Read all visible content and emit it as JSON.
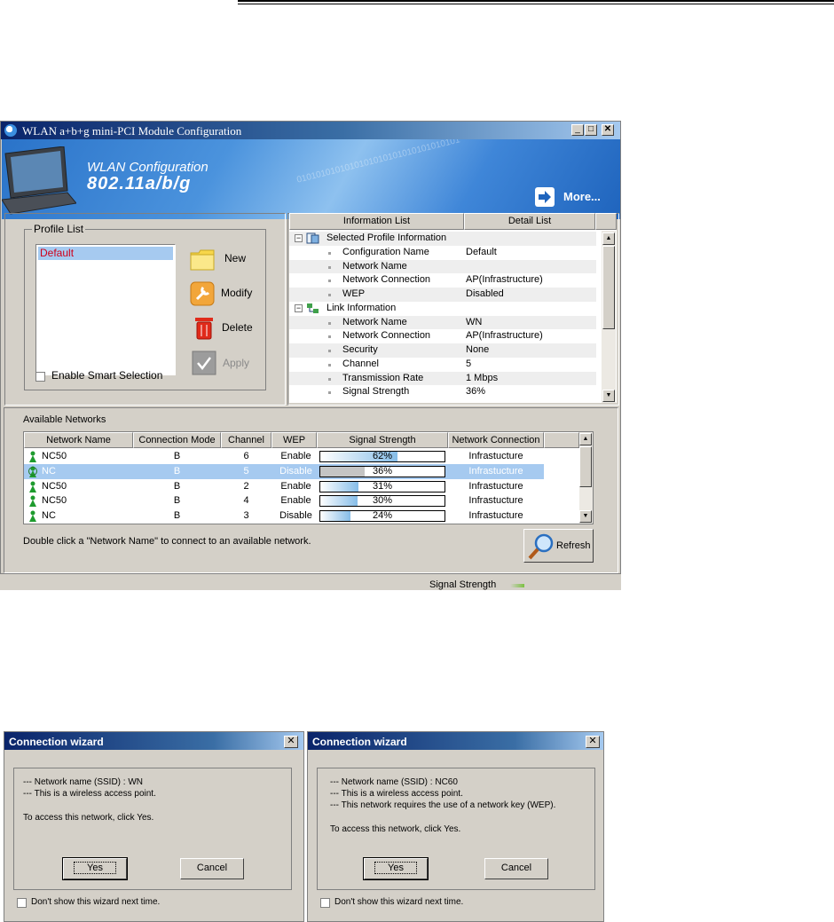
{
  "window": {
    "title": "WLAN a+b+g mini-PCI Module Configuration",
    "banner_line1": "WLAN Configuration",
    "banner_line2": "802.11a/b/g",
    "banner_bits": "0101010101010101010101010101010101",
    "more_label": "More..."
  },
  "profile_list": {
    "legend": "Profile List",
    "items": [
      "Default"
    ],
    "new_label": "New",
    "modify_label": "Modify",
    "delete_label": "Delete",
    "apply_label": "Apply",
    "smart_selection_label": "Enable Smart Selection"
  },
  "info_panel": {
    "tab_info": "Information List",
    "tab_detail": "Detail List",
    "rows": [
      {
        "type": "category",
        "label": "Selected Profile Information",
        "value": ""
      },
      {
        "type": "item",
        "label": "Configuration Name",
        "value": "Default"
      },
      {
        "type": "item",
        "label": "Network Name",
        "value": ""
      },
      {
        "type": "item",
        "label": "Network Connection",
        "value": "AP(Infrastructure)"
      },
      {
        "type": "item",
        "label": "WEP",
        "value": "Disabled"
      },
      {
        "type": "category",
        "label": "Link Information",
        "value": ""
      },
      {
        "type": "item",
        "label": "Network Name",
        "value": "WN"
      },
      {
        "type": "item",
        "label": "Network Connection",
        "value": "AP(Infrastructure)"
      },
      {
        "type": "item",
        "label": "Security",
        "value": "None"
      },
      {
        "type": "item",
        "label": "Channel",
        "value": "5"
      },
      {
        "type": "item",
        "label": "Transmission Rate",
        "value": "1 Mbps"
      },
      {
        "type": "item",
        "label": "Signal Strength",
        "value": "36%"
      }
    ]
  },
  "networks": {
    "section_label": "Available Networks",
    "columns": [
      "Network Name",
      "Connection Mode",
      "Channel",
      "WEP",
      "Signal Strength",
      "Network Connection"
    ],
    "rows": [
      {
        "name": "NC50",
        "mode": "B",
        "channel": "6",
        "wep": "Enable",
        "signal": 62,
        "signal_text": "62%",
        "connection": "Infrastucture",
        "selected": false
      },
      {
        "name": "NC",
        "mode": "B",
        "channel": "5",
        "wep": "Disable",
        "signal": 36,
        "signal_text": "36%",
        "connection": "Infrastucture",
        "selected": true
      },
      {
        "name": "NC50",
        "mode": "B",
        "channel": "2",
        "wep": "Enable",
        "signal": 31,
        "signal_text": "31%",
        "connection": "Infrastucture",
        "selected": false
      },
      {
        "name": "NC50",
        "mode": "B",
        "channel": "4",
        "wep": "Enable",
        "signal": 30,
        "signal_text": "30%",
        "connection": "Infrastucture",
        "selected": false
      },
      {
        "name": "NC",
        "mode": "B",
        "channel": "3",
        "wep": "Disable",
        "signal": 24,
        "signal_text": "24%",
        "connection": "Infrastucture",
        "selected": false
      }
    ],
    "hint": "Double click a \"Network Name\" to connect to an available network.",
    "refresh_label": "Refresh"
  },
  "status_bar": {
    "label": "Signal Strength"
  },
  "dialog1": {
    "title": "Connection wizard",
    "lines": [
      "--- Network name (SSID) : WN",
      "--- This is a wireless access point.",
      "",
      "To access this network, click Yes."
    ],
    "yes_label": "Yes",
    "cancel_label": "Cancel",
    "dont_show_label": "Don't show this wizard next time."
  },
  "dialog2": {
    "title": "Connection wizard",
    "lines": [
      "--- Network name (SSID) : NC60",
      "--- This is a wireless access point.",
      "--- This network requires the use of a network key (WEP).",
      "",
      "To access this network, click Yes."
    ],
    "yes_label": "Yes",
    "cancel_label": "Cancel",
    "dont_show_label": "Don't show this wizard next time."
  },
  "colors": {
    "title_bar": "#0a246a",
    "selection": "#a6caf0",
    "profile_text": "#d0001a",
    "signal_fill": "#86bde8"
  }
}
